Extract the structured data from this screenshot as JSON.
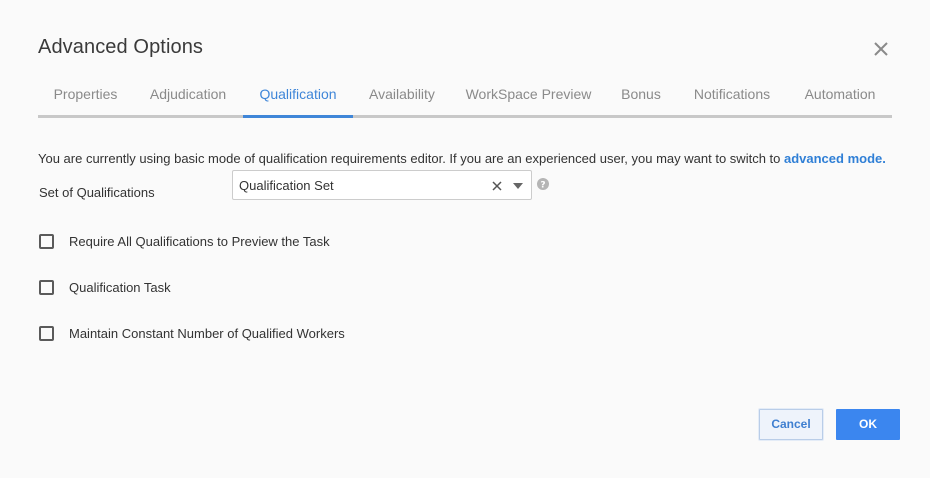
{
  "dialog": {
    "title": "Advanced Options",
    "close_icon": "close-icon"
  },
  "tabs": [
    {
      "label": "Properties",
      "active": false
    },
    {
      "label": "Adjudication",
      "active": false
    },
    {
      "label": "Qualification",
      "active": true
    },
    {
      "label": "Availability",
      "active": false
    },
    {
      "label": "WorkSpace Preview",
      "active": false
    },
    {
      "label": "Bonus",
      "active": false
    },
    {
      "label": "Notifications",
      "active": false
    },
    {
      "label": "Automation",
      "active": false
    }
  ],
  "info": {
    "text": "You are currently using basic mode of qualification requirements editor. If you are an experienced user, you may want to switch to ",
    "link": "advanced mode."
  },
  "qualification_set": {
    "label": "Set of Qualifications",
    "value": "Qualification Set",
    "clear_icon": "clear-icon",
    "dropdown_icon": "chevron-down-icon",
    "help_icon": "help-icon"
  },
  "checkboxes": [
    {
      "label": "Require All Qualifications to Preview the Task",
      "checked": false
    },
    {
      "label": "Qualification Task",
      "checked": false
    },
    {
      "label": "Maintain Constant Number of Qualified Workers",
      "checked": false
    }
  ],
  "buttons": {
    "cancel": "Cancel",
    "ok": "OK"
  },
  "colors": {
    "accent": "#3f86d8",
    "ok_button": "#3b86ef",
    "link": "#2f7fd6"
  }
}
